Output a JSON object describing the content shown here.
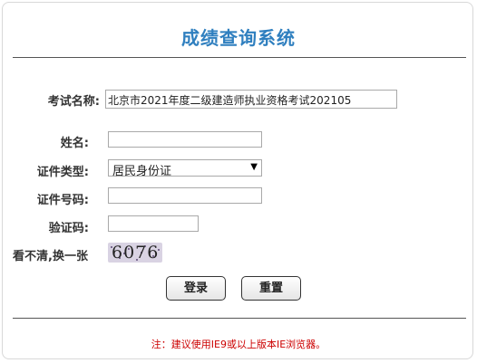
{
  "title": "成绩查询系统",
  "form": {
    "exam_name_label": "考试名称:",
    "exam_name_value": "北京市2021年度二级建造师执业资格考试202105",
    "name_label": "姓名:",
    "name_value": "",
    "id_type_label": "证件类型:",
    "id_type_value": "居民身份证",
    "id_number_label": "证件号码:",
    "id_number_value": "",
    "captcha_label": "验证码:",
    "captcha_input_value": "",
    "refresh_label": "看不清,换一张",
    "captcha_text": "6076"
  },
  "buttons": {
    "login": "登录",
    "reset": "重置"
  },
  "note": "注：建议使用IE9或以上版本IE浏览器。",
  "colors": {
    "title": "#2f7fbf",
    "note": "#cc0000"
  }
}
